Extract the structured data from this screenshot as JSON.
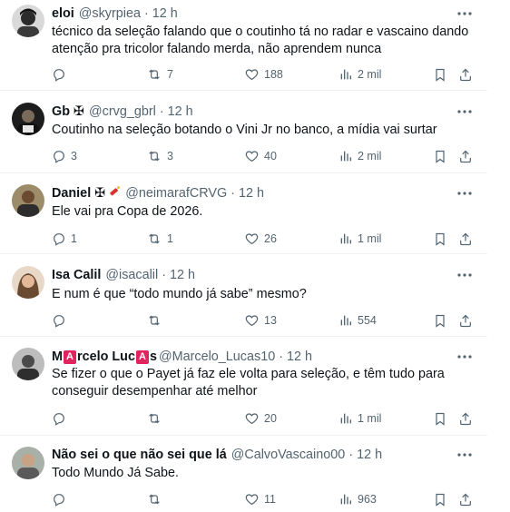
{
  "tweets": [
    {
      "name": "eloi",
      "handle": "@skyrpiea",
      "time": "12 h",
      "text": "técnico da seleção falando que o coutinho tá no radar e vascaino dando atenção pra tricolor falando merda, não aprendem nunca",
      "replies": "",
      "retweets": "7",
      "likes": "188",
      "views": "2 mil",
      "avatar_color": "#2b2b2b"
    },
    {
      "name": "Gb",
      "name_suffix": "✠",
      "handle": "@crvg_gbrl",
      "time": "12 h",
      "text": "Coutinho na seleção botando o Vini Jr no banco, a mídia vai surtar",
      "replies": "3",
      "retweets": "3",
      "likes": "40",
      "views": "2 mil",
      "avatar_color": "#1d1d1d"
    },
    {
      "name": "Daniel",
      "name_suffix": "✠",
      "handle": "@neimarafCRVG",
      "time": "12 h",
      "text": "Ele vai pra Copa de 2026.",
      "replies": "1",
      "retweets": "1",
      "likes": "26",
      "views": "1 mil",
      "avatar_color": "#6b5a3e"
    },
    {
      "name": "Isa Calil",
      "handle": "@isacalil",
      "time": "12 h",
      "text": "E num é que “todo mundo já sabe” mesmo?",
      "replies": "",
      "retweets": "",
      "likes": "13",
      "views": "554",
      "avatar_color": "#c9a98a"
    },
    {
      "name_part1": "M",
      "name_badge1": "A",
      "name_part2": "rcelo Luc",
      "name_badge2": "A",
      "name_part3": "s",
      "handle": "@Marcelo_Lucas10",
      "time": "12 h",
      "text": "Se fizer o que o Payet já faz ele volta para seleção, e têm tudo para conseguir desempenhar até melhor",
      "replies": "",
      "retweets": "",
      "likes": "20",
      "views": "1 mil",
      "avatar_color": "#4a4a4a"
    },
    {
      "name": "Não sei o que não sei que lá",
      "handle": "@CalvoVascaino00",
      "time": "12 h",
      "text": "Todo Mundo Já Sabe.",
      "replies": "",
      "retweets": "",
      "likes": "11",
      "views": "963",
      "avatar_color": "#8a8a8a"
    }
  ],
  "sep": "·",
  "icons": {
    "reply": "reply-icon",
    "retweet": "retweet-icon",
    "like": "heart-icon",
    "views": "views-icon",
    "bookmark": "bookmark-icon",
    "share": "share-icon",
    "more": "more-icon"
  },
  "colors": {
    "text": "#0f1419",
    "muted": "#536471",
    "divider": "#eff3f4",
    "badge": "#e0245e"
  }
}
